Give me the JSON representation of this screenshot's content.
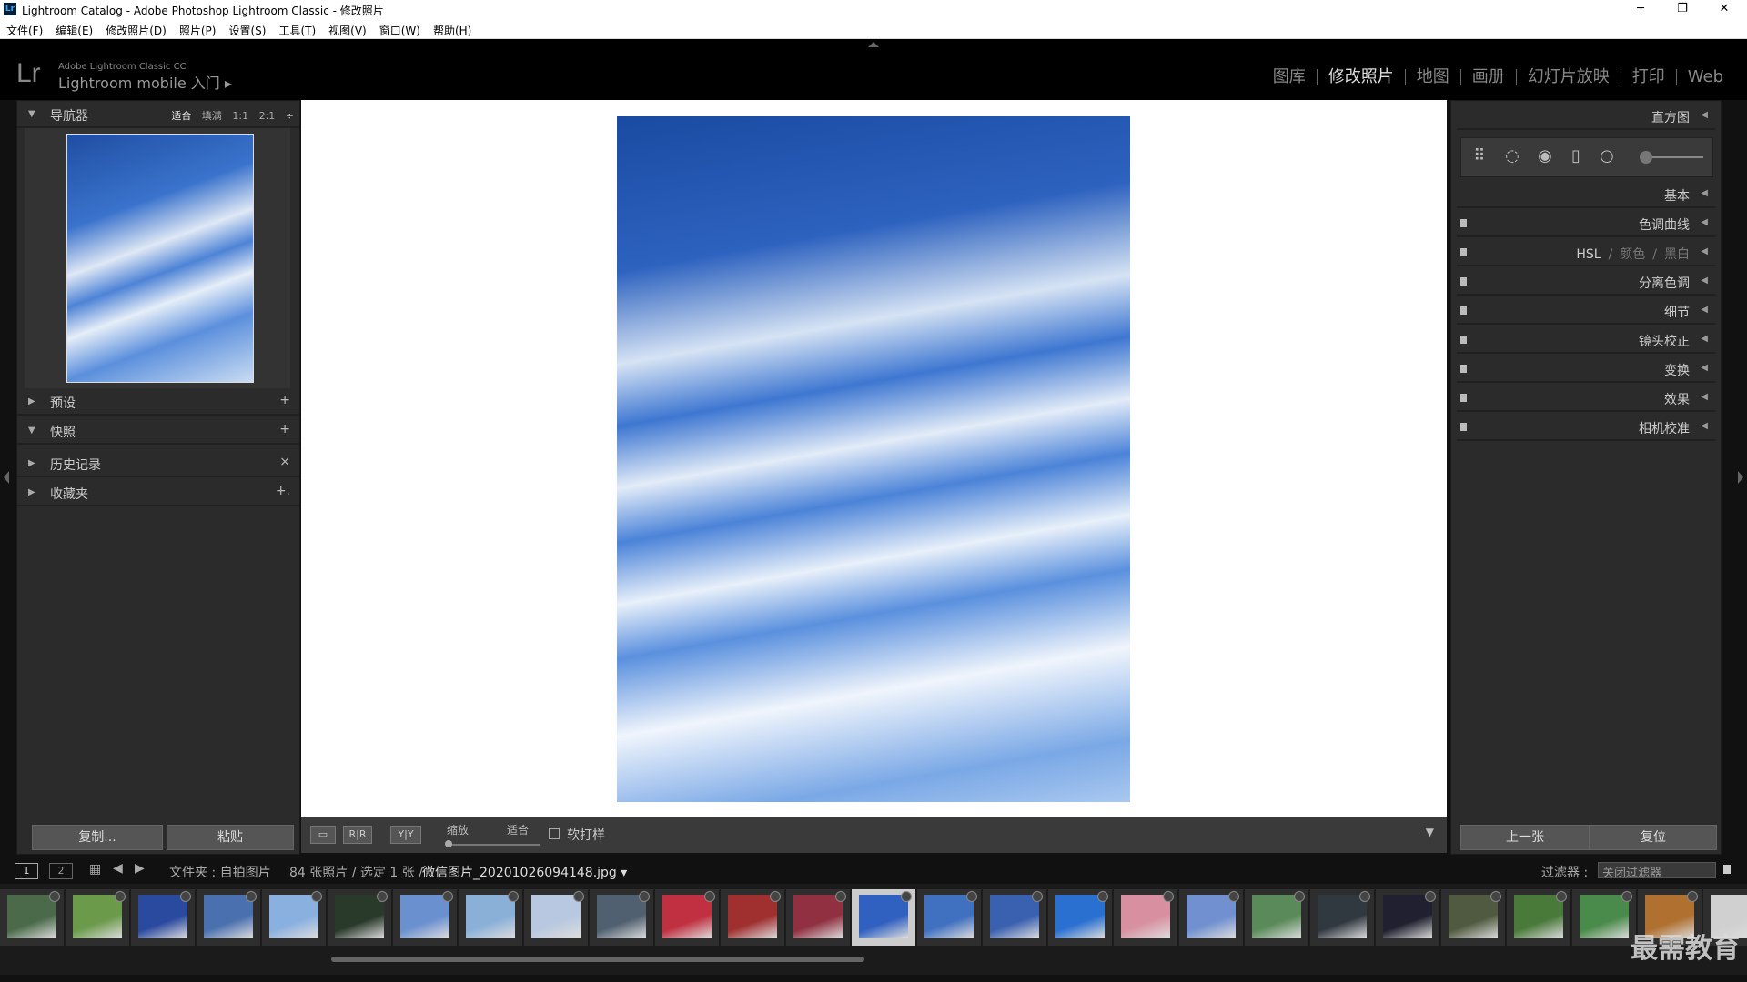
{
  "window": {
    "title": "Lightroom Catalog - Adobe Photoshop Lightroom Classic - 修改照片",
    "icon": "Lr",
    "minimize": "─",
    "restore": "❐",
    "close": "✕"
  },
  "menu": [
    "文件(F)",
    "编辑(E)",
    "修改照片(D)",
    "照片(P)",
    "设置(S)",
    "工具(T)",
    "视图(V)",
    "窗口(W)",
    "帮助(H)"
  ],
  "identity": {
    "logo": "Lr",
    "small": "Adobe Lightroom Classic CC",
    "big": "Lightroom mobile 入门 ▸"
  },
  "modules": [
    {
      "label": "图库",
      "active": false
    },
    {
      "label": "修改照片",
      "active": true
    },
    {
      "label": "地图",
      "active": false
    },
    {
      "label": "画册",
      "active": false
    },
    {
      "label": "幻灯片放映",
      "active": false
    },
    {
      "label": "打印",
      "active": false
    },
    {
      "label": "Web",
      "active": false
    }
  ],
  "left": {
    "navigator": {
      "label": "导航器",
      "options": [
        "适合",
        "填满",
        "1:1",
        "2:1"
      ],
      "selected": "适合",
      "arrow": "÷"
    },
    "panels": [
      {
        "label": "预设",
        "expanded": false,
        "action": "+"
      },
      {
        "label": "快照",
        "expanded": true,
        "action": "+"
      },
      {
        "label": "历史记录",
        "expanded": false,
        "action": "×"
      },
      {
        "label": "收藏夹",
        "expanded": false,
        "action": "+."
      }
    ],
    "copy_button": "复制...",
    "paste_button": "粘贴"
  },
  "right": {
    "histogram": "直方图",
    "basic": "基本",
    "panels": [
      "色调曲线",
      "分离色调",
      "细节",
      "镜头校正",
      "变换",
      "效果",
      "相机校准"
    ],
    "hsl": {
      "a": "HSL",
      "b": "颜色",
      "c": "黑白",
      "sep": "/"
    },
    "prev_button": "上一张",
    "reset_button": "复位"
  },
  "toolbar": {
    "zoom_label": "缩放",
    "fit_label": "适合",
    "soft_proof": "软打样",
    "ra_label": "R|R",
    "yy_label": "Y|Y"
  },
  "filmbar": {
    "page1": "1",
    "page2": "2",
    "path": "文件夹 : 自拍图片",
    "count": "84 张照片 / 选定 1 张 /",
    "filename": "微信图片_20201026094148.jpg ▾",
    "filter_label": "过滤器 :",
    "filter_value": "关闭过滤器"
  },
  "watermark": "最需教育",
  "thumb_colors": [
    "#4a6a4a",
    "#6a9a4a",
    "#2a4aa0",
    "#4a70b0",
    "#8ab0e0",
    "#2a3a2a",
    "#6a90d0",
    "#8ab0d8",
    "#b8c8e0",
    "#506070",
    "#c03040",
    "#a03030",
    "#903040",
    "#3060c0",
    "#4070c0",
    "#3a60b0",
    "#2a70d0",
    "#d890a0",
    "#7090d0",
    "#5a8a5a",
    "#303840",
    "#202030",
    "#505a40",
    "#4a7a3a",
    "#4a8a4a",
    "#b07030",
    "#d0d0d0"
  ]
}
